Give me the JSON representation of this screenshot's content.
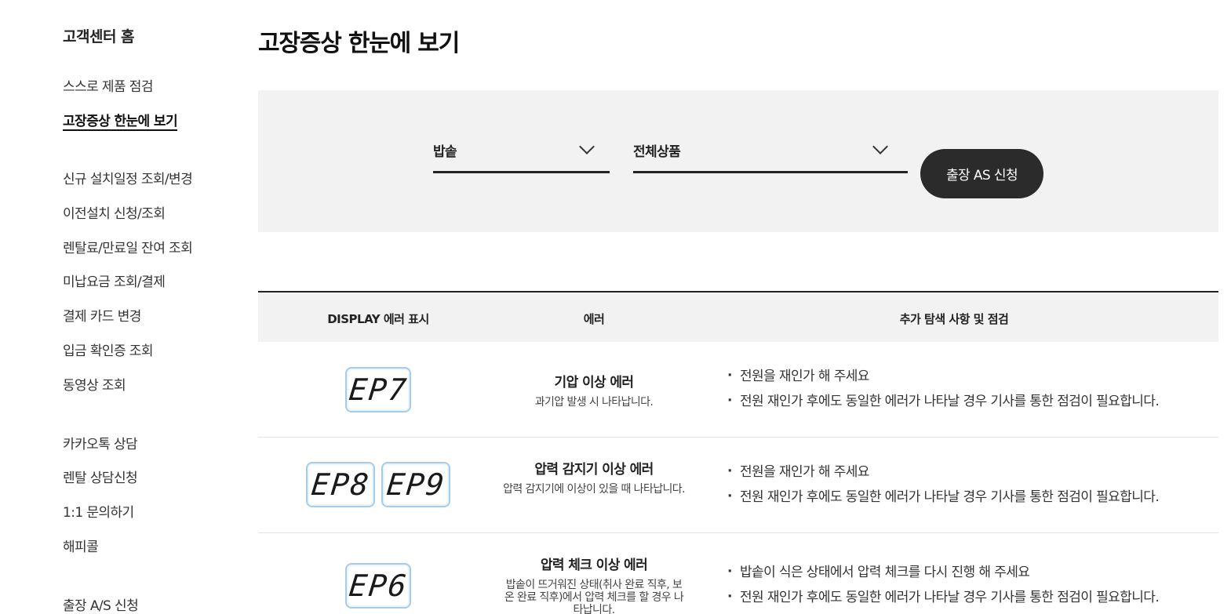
{
  "sidebar": {
    "home": "고객센터 홈",
    "items": [
      "스스로 제품 점검",
      "고장증상 한눈에 보기",
      "신규 설치일정 조회/변경",
      "이전설치 신청/조회",
      "렌탈료/만료일 잔여 조회",
      "미납요금 조회/결제",
      "결제 카드 변경",
      "입금 확인증 조회",
      "동영상 조회",
      "카카오톡 상담",
      "렌탈 상담신청",
      "1:1 문의하기",
      "해피콜",
      "출장 A/S 신청"
    ]
  },
  "page_title": "고장증상 한눈에 보기",
  "filter": {
    "category": "밥솥",
    "product": "전체상품",
    "as_button": "출장 AS 신청"
  },
  "table": {
    "headers": [
      "DISPLAY 에러 표시",
      "에러",
      "추가 탐색 사항 및 점검"
    ],
    "rows": [
      {
        "codes": [
          "EP7"
        ],
        "title": "기압 이상 에러",
        "desc": "과기압 발생 시 나타납니다.",
        "checks": [
          "전원을 재인가 해 주세요",
          "전원 재인가 후에도 동일한 에러가 나타날 경우 기사를 통한 점검이 필요합니다."
        ]
      },
      {
        "codes": [
          "EP8",
          "EP9"
        ],
        "title": "압력 감지기 이상 에러",
        "desc": "압력 감지기에 이상이 있을 때 나타납니다.",
        "checks": [
          "전원을 재인가 해 주세요",
          "전원 재인가 후에도 동일한 에러가 나타날 경우 기사를 통한 점검이 필요합니다."
        ]
      },
      {
        "codes": [
          "EP6"
        ],
        "title": "압력 체크 이상 에러",
        "desc": "밥솥이 뜨거워진 상태(취사 완료 직후, 보온 완료 직후)에서 압력 체크를 할 경우 나타납니다.",
        "checks": [
          "밥솥이 식은 상태에서 압력 체크를 다시 진행 해 주세요",
          "전원 재인가 후에도 동일한 에러가 나타날 경우 기사를 통한 점검이 필요합니다."
        ]
      }
    ]
  },
  "colors": {
    "button_bg": "#2b2b2b",
    "panel_bg": "#f2f2f2",
    "lcd_border": "#a9cbe6"
  }
}
